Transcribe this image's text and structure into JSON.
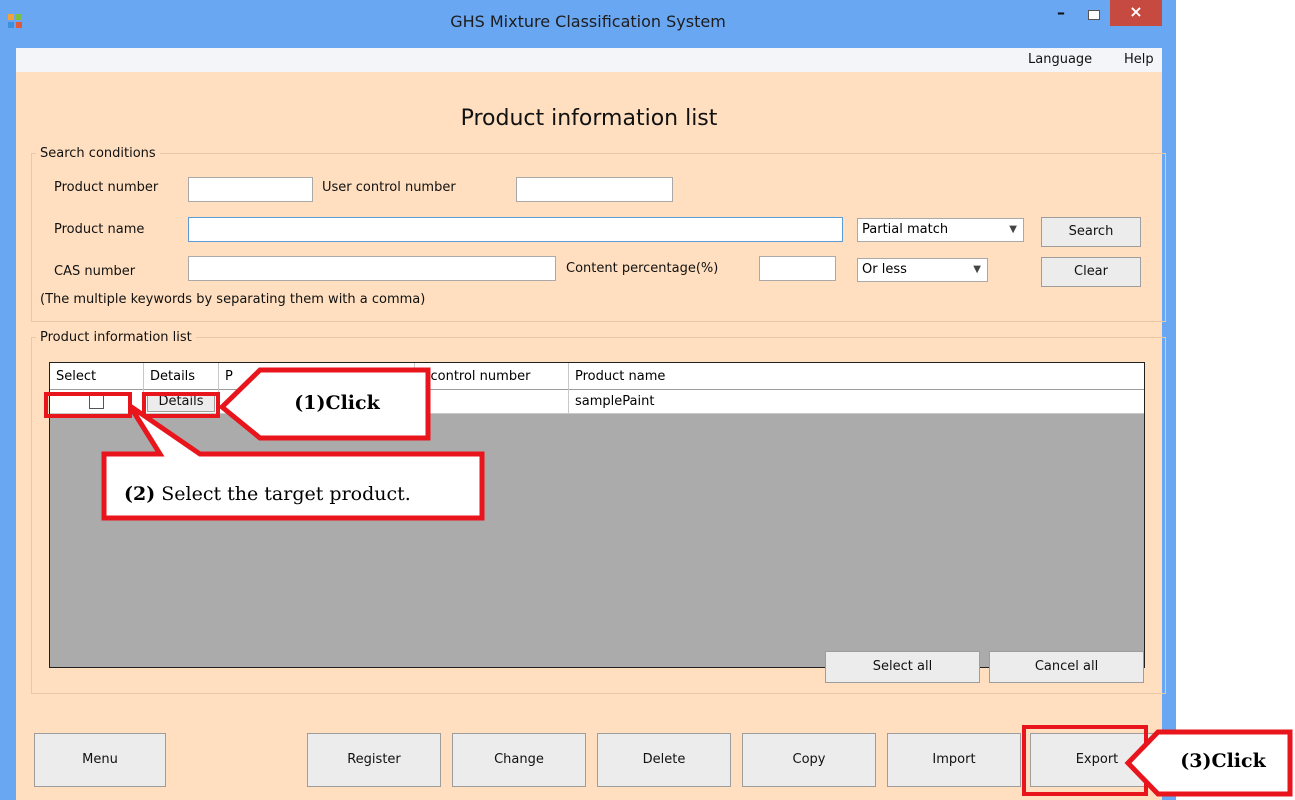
{
  "window": {
    "title": "GHS Mixture Classification System",
    "minimize": "–",
    "close": "×"
  },
  "menubar": {
    "items": [
      "Language",
      "Help"
    ]
  },
  "page": {
    "title": "Product information list"
  },
  "search": {
    "group_label": "Search conditions",
    "product_number_label": "Product number",
    "product_number_value": "",
    "user_control_number_label": "User control number",
    "user_control_number_value": "",
    "product_name_label": "Product name",
    "product_name_value": "",
    "match_mode": "Partial match",
    "cas_number_label": "CAS number",
    "cas_number_value": "",
    "content_percentage_label": "Content percentage(%)",
    "content_percentage_value": "",
    "comparison": "Or less",
    "hint": "(The multiple keywords by separating them with a comma)",
    "search_button": "Search",
    "clear_button": "Clear"
  },
  "list": {
    "group_label": "Product information list",
    "columns": [
      "Select",
      "Details",
      "P",
      "r control number",
      "Product name"
    ],
    "rows": [
      {
        "selected": false,
        "details_button": "Details",
        "product_number": "",
        "user_control_number": "",
        "product_name": "samplePaint"
      }
    ],
    "select_all_button": "Select all",
    "cancel_all_button": "Cancel all"
  },
  "footer": {
    "buttons": [
      "Menu",
      "Register",
      "Change",
      "Delete",
      "Copy",
      "Import",
      "Export"
    ]
  },
  "annotations": {
    "step1": "(1)Click",
    "step2_num": "(2)",
    "step2_text": " Select the target product.",
    "step3": "(3)Click"
  },
  "colors": {
    "title_bar": "#6aa7f2",
    "client_bg": "#ffdfbf",
    "grid_bg": "#ababab",
    "callout_red": "#e8151c"
  }
}
